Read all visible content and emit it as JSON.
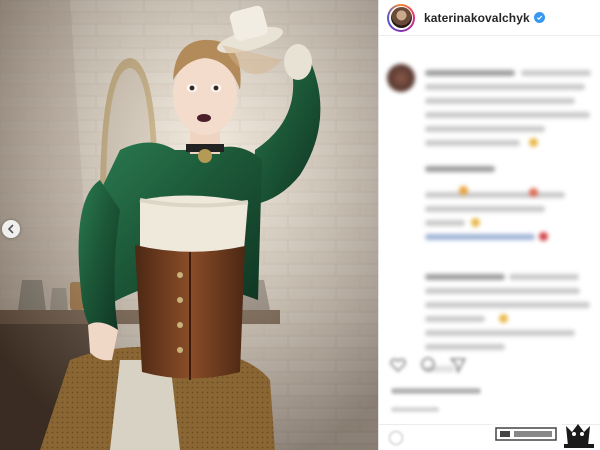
{
  "post": {
    "username": "katerinakovalchyk",
    "verified": true,
    "verified_icon": "verified-badge-icon",
    "prev_icon": "chevron-left-icon"
  },
  "actions": {
    "icons": [
      "heart-icon",
      "comment-icon",
      "share-icon",
      "bookmark-icon"
    ]
  },
  "colors": {
    "accent": "#3897f0",
    "jacket": "#1f5a3b",
    "corset": "#6b3a1f",
    "skirt": "#8a6a3a"
  }
}
